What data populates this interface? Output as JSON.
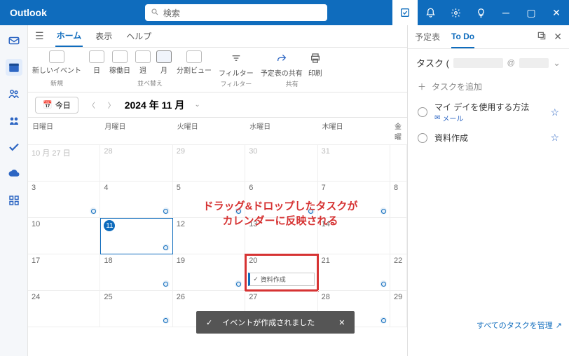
{
  "app_name": "Outlook",
  "search_placeholder": "検索",
  "tabs": {
    "home": "ホーム",
    "view": "表示",
    "help": "ヘルプ"
  },
  "ribbon": {
    "new_event": "新しいイベント",
    "new_group": "新規",
    "day": "日",
    "workweek": "稼働日",
    "week": "週",
    "month": "月",
    "arrange_group": "並べ替え",
    "split": "分割ビュー",
    "filter": "フィルター",
    "filter_group": "フィルター",
    "share_cal": "予定表の共有",
    "print": "印刷",
    "share_group": "共有"
  },
  "monthbar": {
    "today": "今日",
    "label": "2024 年 11 月"
  },
  "daynames": [
    "日曜日",
    "月曜日",
    "火曜日",
    "水曜日",
    "木曜日",
    "金曜"
  ],
  "weeks": [
    [
      {
        "num": "10 月 27 日",
        "prev": true,
        "dot": false
      },
      {
        "num": "28",
        "prev": true,
        "dot": false
      },
      {
        "num": "29",
        "prev": true,
        "dot": false
      },
      {
        "num": "30",
        "prev": true,
        "dot": false
      },
      {
        "num": "31",
        "prev": true,
        "dot": false
      },
      {
        "num": "",
        "dot": false
      }
    ],
    [
      {
        "num": "3",
        "dot": true
      },
      {
        "num": "4",
        "dot": true
      },
      {
        "num": "5",
        "dot": true
      },
      {
        "num": "6",
        "dot": true
      },
      {
        "num": "7",
        "dot": true
      },
      {
        "num": "8",
        "dot": false
      }
    ],
    [
      {
        "num": "10",
        "dot": false
      },
      {
        "num": "11",
        "dot": true,
        "today": true
      },
      {
        "num": "12",
        "dot": false
      },
      {
        "num": "13",
        "dot": false
      },
      {
        "num": "14",
        "dot": false
      },
      {
        "num": "",
        "dot": false
      }
    ],
    [
      {
        "num": "17",
        "dot": false
      },
      {
        "num": "18",
        "dot": true
      },
      {
        "num": "19",
        "dot": true
      },
      {
        "num": "20",
        "dot": false,
        "event": "資料作成",
        "highlight": true
      },
      {
        "num": "21",
        "dot": true
      },
      {
        "num": "22",
        "dot": false
      }
    ],
    [
      {
        "num": "24",
        "dot": false
      },
      {
        "num": "25",
        "dot": true
      },
      {
        "num": "26",
        "dot": true
      },
      {
        "num": "27",
        "dot": true
      },
      {
        "num": "28",
        "dot": true
      },
      {
        "num": "29",
        "dot": false
      }
    ]
  ],
  "side": {
    "tab1": "予定表",
    "tab2": "To Do",
    "heading_prefix": "タスク (",
    "heading_at": "@",
    "add_task": "タスクを追加",
    "tasks": [
      {
        "title": "マイ デイを使用する方法",
        "sub": "メール"
      },
      {
        "title": "資料作成"
      }
    ],
    "manage": "すべてのタスクを管理"
  },
  "toast": "イベントが作成されました",
  "annotation_l1": "ドラッグ&ドロップしたタスクが",
  "annotation_l2": "カレンダーに反映される"
}
